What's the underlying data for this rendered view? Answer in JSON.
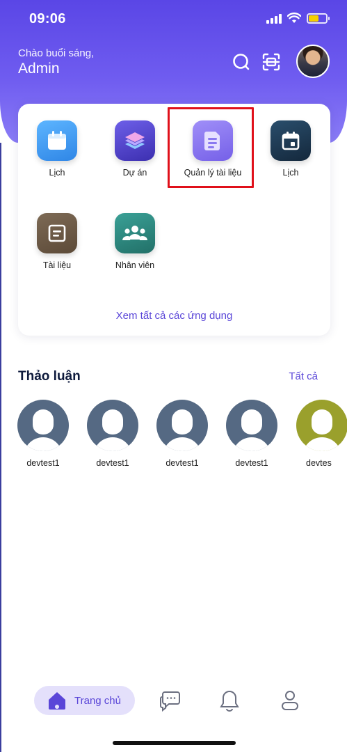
{
  "status_bar": {
    "time": "09:06"
  },
  "header": {
    "greeting": "Chào buổi sáng,",
    "user_name": "Admin",
    "icons": [
      "search-icon",
      "scan-icon",
      "avatar"
    ]
  },
  "apps": [
    {
      "label": "Lịch",
      "icon": "calendar-icon",
      "color": "#3a97ee"
    },
    {
      "label": "Dự án",
      "icon": "layers-icon",
      "color": "#5b4bd8"
    },
    {
      "label": "Quản lý tài liệu",
      "icon": "document-icon",
      "color": "#8877f0"
    },
    {
      "label": "Lịch",
      "icon": "calendar-dark-icon",
      "color": "#1e3d57"
    },
    {
      "label": "Tài liệu",
      "icon": "note-icon",
      "color": "#6f5c49"
    },
    {
      "label": "Nhân viên",
      "icon": "people-icon",
      "color": "#2f8b82"
    }
  ],
  "see_all_apps": "Xem tất cả các ứng dụng",
  "discussions": {
    "title": "Thảo luận",
    "see_all": "Tất cả",
    "people": [
      {
        "name": "devtest1",
        "color": "#556983"
      },
      {
        "name": "devtest1",
        "color": "#556983"
      },
      {
        "name": "devtest1",
        "color": "#556983"
      },
      {
        "name": "devtest1",
        "color": "#556983"
      },
      {
        "name": "devtes",
        "color": "#9aa02c"
      }
    ]
  },
  "bottom_nav": {
    "home_label": "Trang chủ",
    "items": [
      "home-icon",
      "chat-icon",
      "bell-icon",
      "profile-icon"
    ]
  },
  "colors": {
    "accent": "#5a46d8",
    "header": "#6f5cf0",
    "highlight": "#e0101a"
  }
}
